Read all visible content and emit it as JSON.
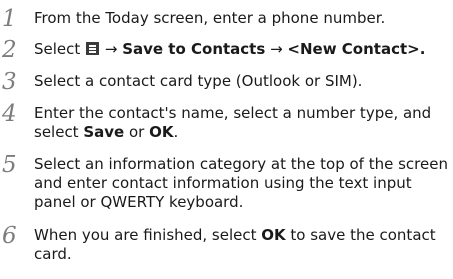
{
  "steps": [
    {
      "number": "1",
      "line1": "From the Today screen, enter a phone number."
    },
    {
      "number": "2",
      "select": "Select",
      "arrow1": "→",
      "save_to_contacts": "Save to Contacts",
      "arrow2": "→",
      "new_contact": "<New Contact>",
      "end": "."
    },
    {
      "number": "3",
      "line1": "Select a contact card type (Outlook or SIM)."
    },
    {
      "number": "4",
      "line1": "Enter the contact's name, select a number type, and",
      "line2_before": "select ",
      "save": "Save",
      "or": " or ",
      "ok": "OK",
      "end": "."
    },
    {
      "number": "5",
      "line1": "Select an information category at the top of the screen",
      "line2": "and enter contact information using the text input",
      "line3": "panel or QWERTY keyboard."
    },
    {
      "number": "6",
      "line1_before": "When you are finished, select ",
      "ok": "OK",
      "line1_after": " to save the contact",
      "line2": "card."
    }
  ],
  "icons": {
    "menu": "menu-icon"
  }
}
